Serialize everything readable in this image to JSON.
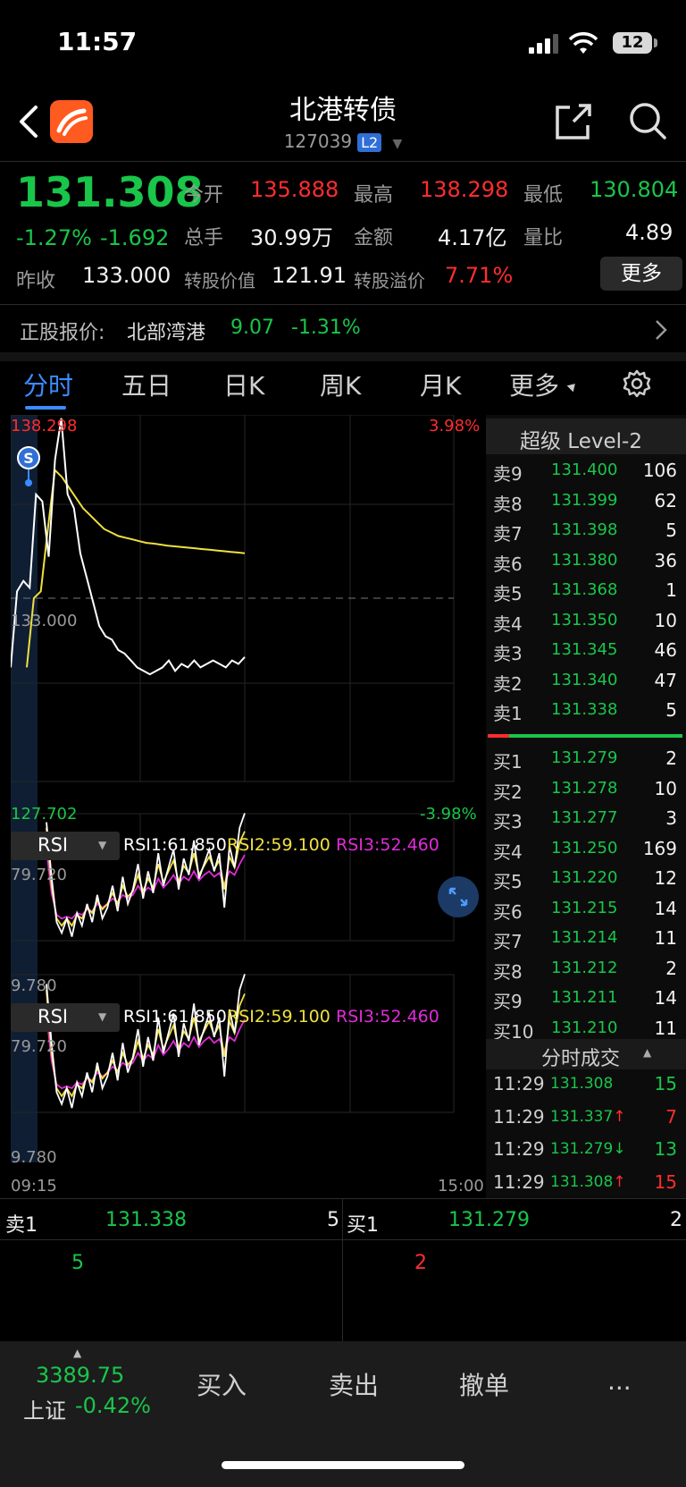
{
  "status_bar": {
    "time": "11:57",
    "battery": "12"
  },
  "header": {
    "title": "北港转债",
    "code": "127039",
    "level_badge": "L2"
  },
  "quote": {
    "price": "131.308",
    "change_pct": "-1.27%",
    "change_abs": "-1.692",
    "open_label": "今开",
    "open": "135.888",
    "high_label": "最高",
    "high": "138.298",
    "low_label": "最低",
    "low": "130.804",
    "volume_label": "总手",
    "volume": "30.99万",
    "amount_label": "金额",
    "amount": "4.17亿",
    "ratio_label": "量比",
    "ratio": "4.89",
    "prev_close_label": "昨收",
    "prev_close": "133.000",
    "conv_value_label": "转股价值",
    "conv_value": "121.91",
    "premium_label": "转股溢价",
    "premium": "7.71%",
    "more_button": "更多"
  },
  "underlying": {
    "label": "正股报价:",
    "name": "北部湾港",
    "price": "9.07",
    "change": "-1.31%"
  },
  "tabs": [
    "分时",
    "五日",
    "日K",
    "周K",
    "月K",
    "更多"
  ],
  "chart_data": [
    {
      "type": "line",
      "title": "",
      "y_max_label": "138.298",
      "y_min_label": "127.702",
      "y_mid_label": "133.000",
      "pct_max_label": "3.98%",
      "pct_min_label": "-3.98%",
      "x_start": "09:15",
      "x_end": "15:00",
      "ylim": [
        127.702,
        138.298
      ],
      "series": [
        {
          "color": "#ffffff",
          "values": [
            131.0,
            133.2,
            133.5,
            133.3,
            136.0,
            135.8,
            134.2,
            137.0,
            138.2,
            136.0,
            135.6,
            134.3,
            133.6,
            132.9,
            132.2,
            131.9,
            131.8,
            131.5,
            131.4,
            131.2,
            131.0,
            130.9,
            130.8,
            130.9,
            131.0,
            131.2,
            130.9,
            131.1,
            131.0,
            131.2,
            131.0,
            131.1,
            131.2,
            131.1,
            131.0,
            131.2,
            131.1,
            131.3
          ]
        },
        {
          "color": "#f0e040",
          "values": [
            131.0,
            133.0,
            133.2,
            135.0,
            136.7,
            136.5,
            136.2,
            135.9,
            135.6,
            135.4,
            135.2,
            135.0,
            134.9,
            134.8,
            134.75,
            134.7,
            134.65,
            134.6,
            134.58,
            134.55,
            134.52,
            134.5,
            134.48,
            134.46,
            134.44,
            134.42,
            134.4,
            134.38,
            134.36,
            134.34,
            134.32,
            134.3
          ]
        }
      ],
      "marker": "S"
    },
    {
      "type": "line",
      "indicator": "RSI",
      "rsi1_label": "RSI1:61.850",
      "rsi2_label": "RSI2:59.100",
      "rsi3_label": "RSI3:52.460",
      "y_max_label": "79.720",
      "y_min_label": "9.780",
      "ylim": [
        9.78,
        79.72
      ],
      "series": [
        {
          "name": "RSI1",
          "color": "#ffffff",
          "values": [
            75,
            45,
            20,
            14,
            22,
            12,
            25,
            18,
            30,
            20,
            35,
            22,
            28,
            40,
            26,
            45,
            30,
            38,
            52,
            33,
            48,
            36,
            58,
            40,
            50,
            60,
            38,
            55,
            46,
            65,
            44,
            52,
            60,
            48,
            58,
            28,
            62,
            50,
            72,
            80
          ]
        },
        {
          "name": "RSI2",
          "color": "#f0e040",
          "values": [
            72,
            40,
            22,
            18,
            22,
            18,
            24,
            22,
            28,
            25,
            32,
            27,
            30,
            36,
            30,
            40,
            34,
            37,
            46,
            37,
            44,
            39,
            52,
            42,
            48,
            54,
            42,
            51,
            47,
            58,
            46,
            51,
            56,
            49,
            54,
            38,
            56,
            50,
            64,
            70
          ]
        },
        {
          "name": "RSI3",
          "color": "#e22bd8",
          "values": [
            60,
            36,
            24,
            22,
            23,
            22,
            25,
            24,
            27,
            26,
            30,
            28,
            30,
            33,
            31,
            35,
            33,
            35,
            40,
            36,
            39,
            37,
            44,
            39,
            42,
            46,
            41,
            45,
            43,
            48,
            43,
            46,
            48,
            45,
            47,
            41,
            48,
            46,
            52,
            57
          ]
        }
      ]
    },
    {
      "type": "line",
      "indicator": "RSI",
      "rsi1_label": "RSI1:61.850",
      "rsi2_label": "RSI2:59.100",
      "rsi3_label": "RSI3:52.460",
      "y_max_label": "79.720",
      "y_min_label": "9.780",
      "ylim": [
        9.78,
        79.72
      ]
    }
  ],
  "order_book": {
    "title": "超级 Level-2",
    "asks": [
      {
        "label": "卖9",
        "price": "131.400",
        "vol": "106"
      },
      {
        "label": "卖8",
        "price": "131.399",
        "vol": "62"
      },
      {
        "label": "卖7",
        "price": "131.398",
        "vol": "5"
      },
      {
        "label": "卖6",
        "price": "131.380",
        "vol": "36"
      },
      {
        "label": "卖5",
        "price": "131.368",
        "vol": "1"
      },
      {
        "label": "卖4",
        "price": "131.350",
        "vol": "10"
      },
      {
        "label": "卖3",
        "price": "131.345",
        "vol": "46"
      },
      {
        "label": "卖2",
        "price": "131.340",
        "vol": "47"
      },
      {
        "label": "卖1",
        "price": "131.338",
        "vol": "5"
      }
    ],
    "bids": [
      {
        "label": "买1",
        "price": "131.279",
        "vol": "2"
      },
      {
        "label": "买2",
        "price": "131.278",
        "vol": "10"
      },
      {
        "label": "买3",
        "price": "131.277",
        "vol": "3"
      },
      {
        "label": "买4",
        "price": "131.250",
        "vol": "169"
      },
      {
        "label": "买5",
        "price": "131.220",
        "vol": "12"
      },
      {
        "label": "买6",
        "price": "131.215",
        "vol": "14"
      },
      {
        "label": "买7",
        "price": "131.214",
        "vol": "11"
      },
      {
        "label": "买8",
        "price": "131.212",
        "vol": "2"
      },
      {
        "label": "买9",
        "price": "131.211",
        "vol": "14"
      },
      {
        "label": "买10",
        "price": "131.210",
        "vol": "11"
      }
    ],
    "trades_title": "分时成交",
    "trades": [
      {
        "time": "11:29",
        "price": "131.308",
        "arrow": "",
        "vol": "15",
        "vol_color": "#19c64a"
      },
      {
        "time": "11:29",
        "price": "131.337",
        "arrow": "↑",
        "vol": "7",
        "vol_color": "#ff2d2d"
      },
      {
        "time": "11:29",
        "price": "131.279",
        "arrow": "↓",
        "vol": "13",
        "vol_color": "#19c64a"
      },
      {
        "time": "11:29",
        "price": "131.308",
        "arrow": "↑",
        "vol": "15",
        "vol_color": "#ff2d2d"
      }
    ]
  },
  "bottom_book": {
    "ask_label": "卖1",
    "ask_price": "131.338",
    "ask_vol": "5",
    "bid_label": "买1",
    "bid_price": "131.279",
    "bid_vol": "2",
    "ask_queue": "5",
    "bid_queue": "2"
  },
  "bottom_bar": {
    "index_value": "3389.75",
    "index_name": "上证",
    "index_change": "-0.42%",
    "buy": "买入",
    "sell": "卖出",
    "cancel": "撤单",
    "more": "..."
  }
}
